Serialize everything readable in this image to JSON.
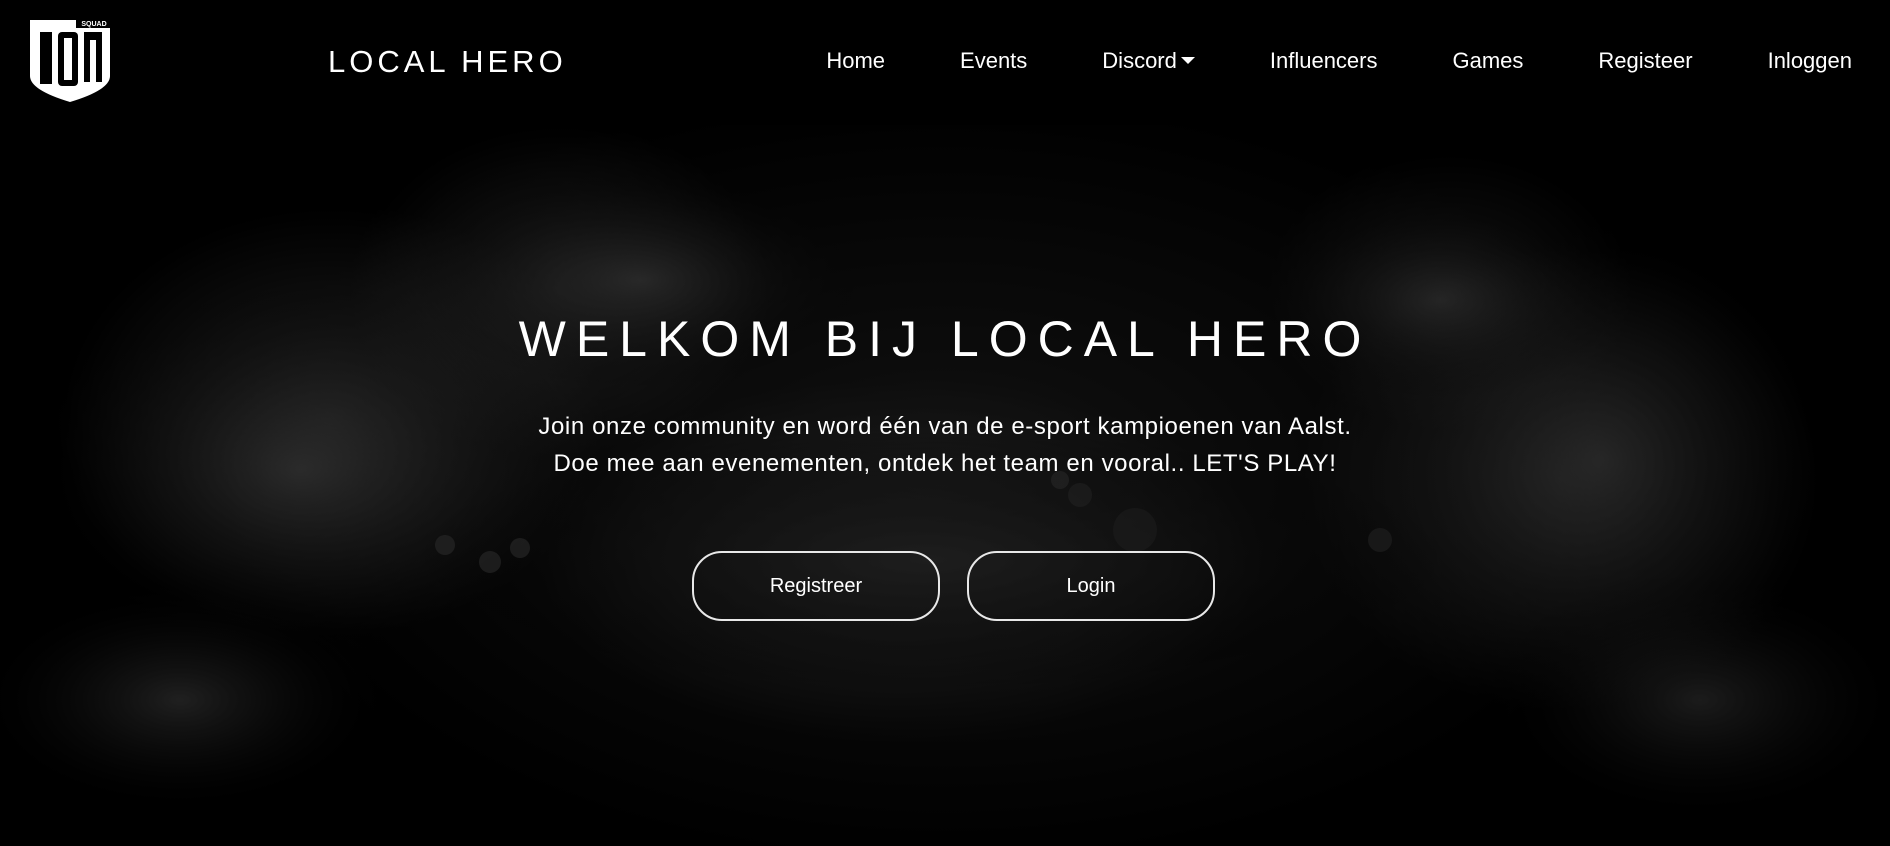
{
  "brand": {
    "logo_text": "SQUAD",
    "name": "LOCAL HERO"
  },
  "nav": {
    "items": [
      {
        "label": "Home"
      },
      {
        "label": "Events"
      },
      {
        "label": "Discord",
        "has_dropdown": true
      },
      {
        "label": "Influencers"
      },
      {
        "label": "Games"
      },
      {
        "label": "Registeer"
      },
      {
        "label": "Inloggen"
      }
    ]
  },
  "hero": {
    "title": "WELKOM BIJ LOCAL HERO",
    "line1": "Join onze community en word één van de e-sport kampioenen van Aalst.",
    "line2": "Doe mee aan evenementen, ontdek het team en vooral.. LET'S PLAY!",
    "register_label": "Registreer",
    "login_label": "Login"
  },
  "colors": {
    "background": "#000000",
    "text": "#ffffff",
    "button_border": "#e8e8e8"
  }
}
